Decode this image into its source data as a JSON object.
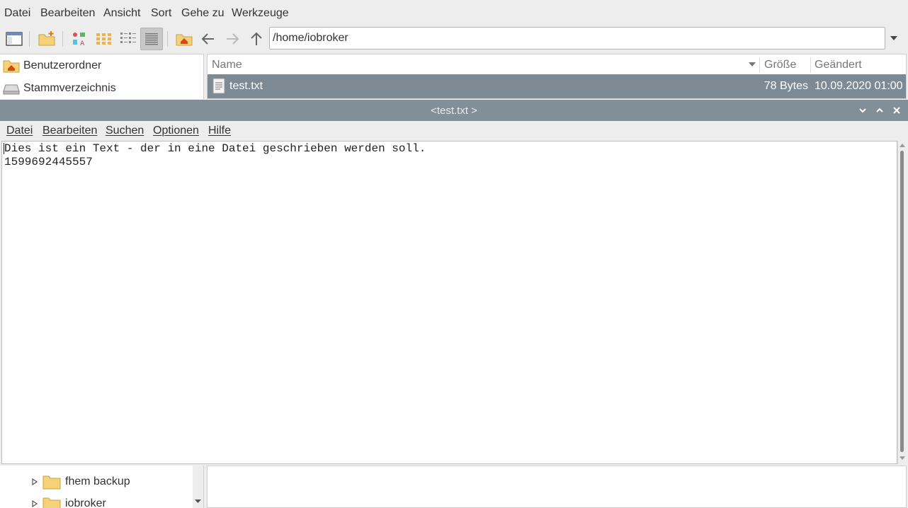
{
  "file_manager": {
    "menu": [
      "Datei",
      "Bearbeiten",
      "Ansicht",
      "Sort",
      "Gehe zu",
      "Werkzeuge"
    ],
    "address": "/home/iobroker",
    "places": [
      "Benutzerordner",
      "Stammverzeichnis"
    ],
    "columns": {
      "name": "Name",
      "size": "Größe",
      "modified": "Geändert"
    },
    "files": [
      {
        "name": "test.txt",
        "size": "78 Bytes",
        "modified": "10.09.2020 01:00",
        "selected": true
      }
    ],
    "tree": [
      "fhem backup",
      "iobroker"
    ]
  },
  "editor": {
    "title": "<test.txt >",
    "menu": [
      "Datei",
      "Bearbeiten",
      "Suchen",
      "Optionen",
      "Hilfe"
    ],
    "lines": [
      "Dies ist ein Text - der in eine Datei geschrieben werden soll.",
      "1599692445557"
    ]
  },
  "colors": {
    "selection": "#7d8a93",
    "titlebar": "#818f98",
    "folder": "#f5d27a"
  }
}
